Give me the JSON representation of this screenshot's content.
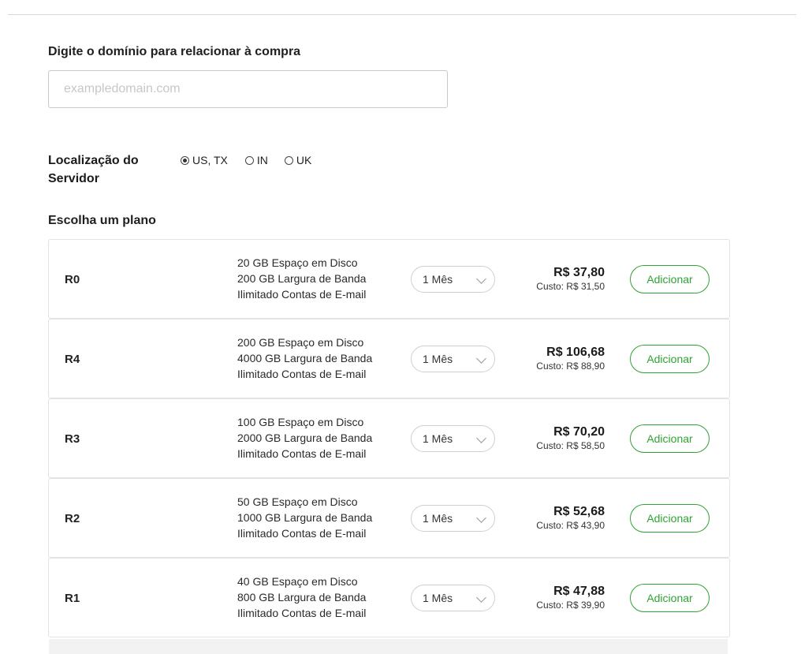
{
  "domain": {
    "label": "Digite o domínio para relacionar à compra",
    "value": "",
    "placeholder": "exampledomain.com"
  },
  "location": {
    "label": "Localização do Servidor",
    "options": [
      {
        "label": "US, TX",
        "selected": true
      },
      {
        "label": "IN",
        "selected": false
      },
      {
        "label": "UK",
        "selected": false
      }
    ]
  },
  "plans": {
    "heading": "Escolha um plano",
    "add_label": "Adicionar",
    "items": [
      {
        "name": "R0",
        "features": [
          "20 GB Espaço em Disco",
          "200 GB Largura de Banda",
          "Ilimitado Contas de E-mail"
        ],
        "term": "1 Mês",
        "price": "R$ 37,80",
        "cost": "Custo: R$ 31,50"
      },
      {
        "name": "R4",
        "features": [
          "200 GB Espaço em Disco",
          "4000 GB Largura de Banda",
          "Ilimitado Contas de E-mail"
        ],
        "term": "1 Mês",
        "price": "R$ 106,68",
        "cost": "Custo: R$ 88,90"
      },
      {
        "name": "R3",
        "features": [
          "100 GB Espaço em Disco",
          "2000 GB Largura de Banda",
          "Ilimitado Contas de E-mail"
        ],
        "term": "1 Mês",
        "price": "R$ 70,20",
        "cost": "Custo: R$ 58,50"
      },
      {
        "name": "R2",
        "features": [
          "50 GB Espaço em Disco",
          "1000 GB Largura de Banda",
          "Ilimitado Contas de E-mail"
        ],
        "term": "1 Mês",
        "price": "R$ 52,68",
        "cost": "Custo: R$ 43,90"
      },
      {
        "name": "R1",
        "features": [
          "40 GB Espaço em Disco",
          "800 GB Largura de Banda",
          "Ilimitado Contas de E-mail"
        ],
        "term": "1 Mês",
        "price": "R$ 47,88",
        "cost": "Custo: R$ 39,90"
      }
    ]
  },
  "colors": {
    "accent": "#2fa333",
    "border": "#e3e3e3"
  }
}
